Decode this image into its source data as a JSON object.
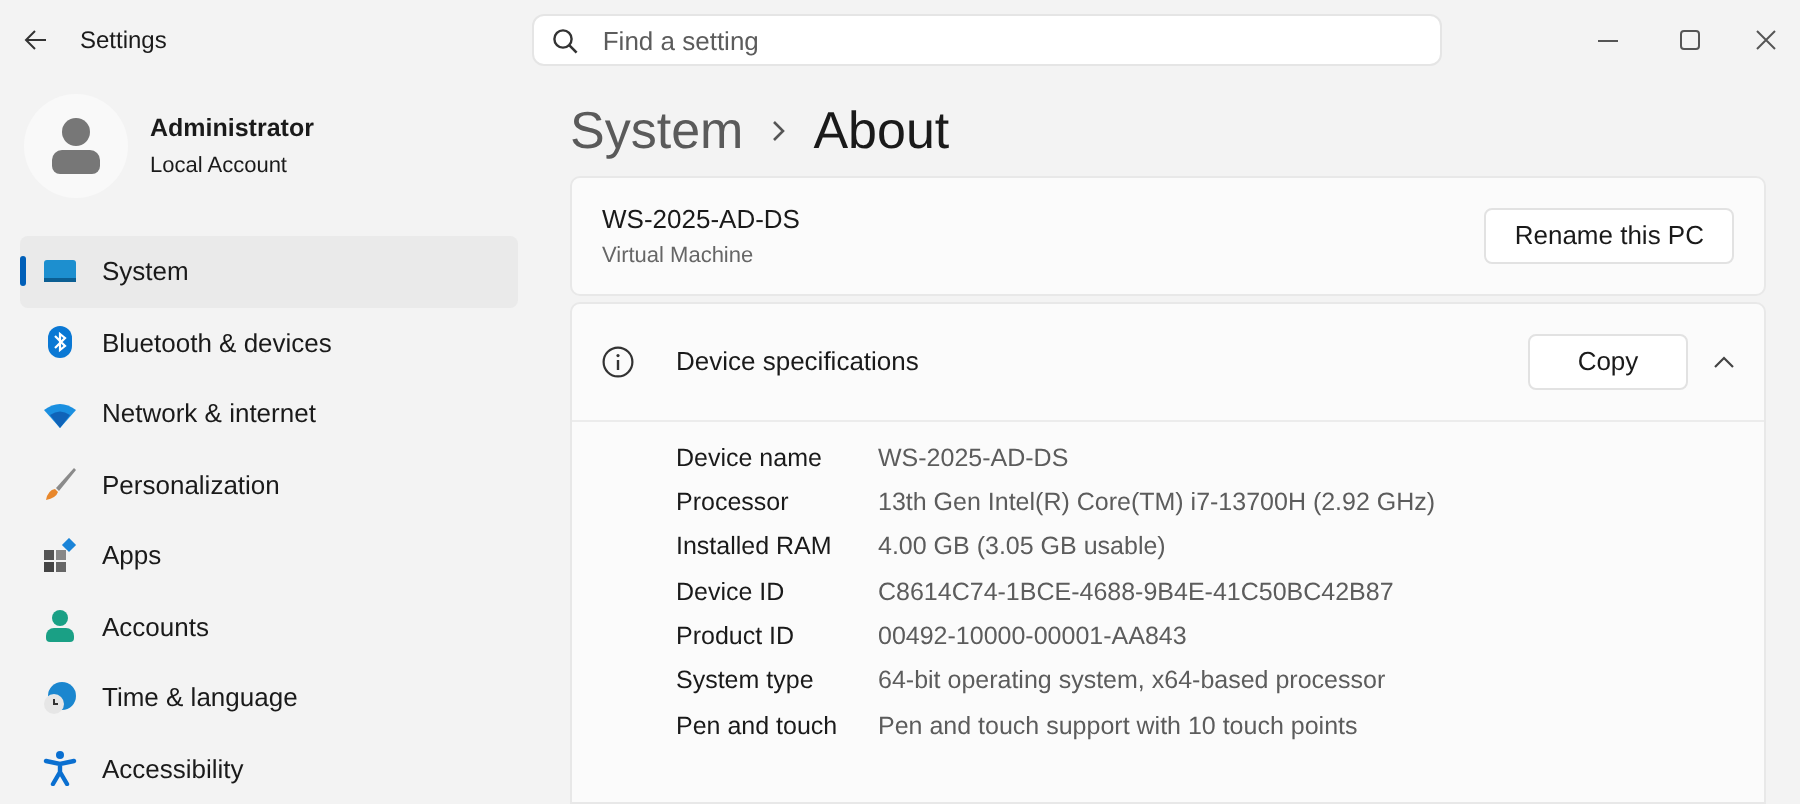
{
  "window": {
    "title": "Settings"
  },
  "search": {
    "placeholder": "Find a setting"
  },
  "account": {
    "name": "Administrator",
    "type": "Local Account"
  },
  "sidebar": {
    "items": [
      {
        "label": "System",
        "kind": "system",
        "selected": true
      },
      {
        "label": "Bluetooth & devices",
        "kind": "bluetooth",
        "selected": false
      },
      {
        "label": "Network & internet",
        "kind": "network",
        "selected": false
      },
      {
        "label": "Personalization",
        "kind": "brush",
        "selected": false
      },
      {
        "label": "Apps",
        "kind": "apps",
        "selected": false
      },
      {
        "label": "Accounts",
        "kind": "accounts",
        "selected": false
      },
      {
        "label": "Time & language",
        "kind": "time",
        "selected": false
      },
      {
        "label": "Accessibility",
        "kind": "accessibility",
        "selected": false
      }
    ]
  },
  "breadcrumb": [
    "System",
    "About"
  ],
  "pc": {
    "name": "WS-2025-AD-DS",
    "subtitle": "Virtual Machine",
    "button": "Rename this PC"
  },
  "specs": {
    "title": "Device specifications",
    "button": "Copy",
    "expanded": true,
    "rows": [
      {
        "label": "Device name",
        "value": "WS-2025-AD-DS"
      },
      {
        "label": "Processor",
        "value": "13th Gen Intel(R) Core(TM) i7-13700H (2.92 GHz)"
      },
      {
        "label": "Installed RAM",
        "value": "4.00 GB (3.05 GB usable)"
      },
      {
        "label": "Device ID",
        "value": "C8614C74-1BCE-4688-9B4E-41C50BC42B87"
      },
      {
        "label": "Product ID",
        "value": "00492-10000-00001-AA843"
      },
      {
        "label": "System type",
        "value": "64-bit operating system, x64-based processor"
      },
      {
        "label": "Pen and touch",
        "value": "Pen and touch support with 10 touch points"
      }
    ]
  }
}
